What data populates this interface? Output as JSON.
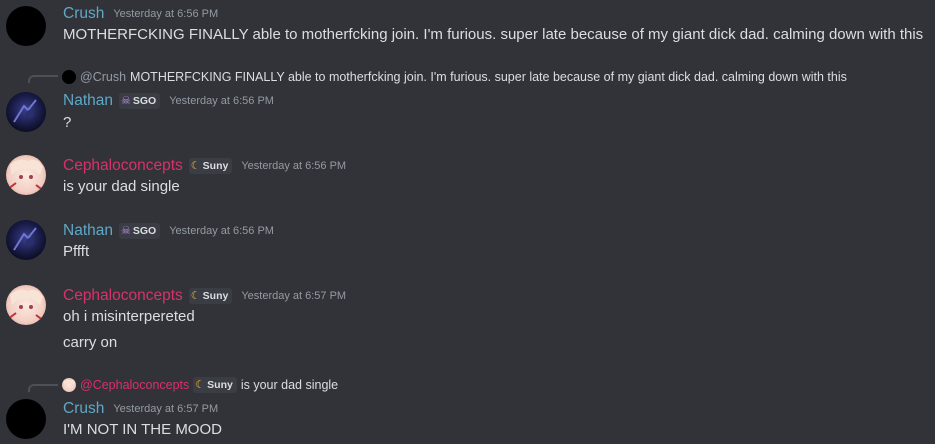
{
  "messages": {
    "m1": {
      "username": "Crush",
      "timestamp": "Yesterday at 6:56 PM",
      "text": "MOTHERFCKING FINALLY able to motherfcking join. I'm furious. super late because of my giant dick dad. calming down with this"
    },
    "m2": {
      "reply_mention": "@Crush",
      "reply_text": "MOTHERFCKING FINALLY able to motherfcking join. I'm furious. super late because of my giant dick dad. calming down with this",
      "username": "Nathan",
      "tag": "SGO",
      "timestamp": "Yesterday at 6:56 PM",
      "text": "?"
    },
    "m3": {
      "username": "Cephaloconcepts",
      "tag": "Suny",
      "timestamp": "Yesterday at 6:56 PM",
      "text": "is your dad single"
    },
    "m4": {
      "username": "Nathan",
      "tag": "SGO",
      "timestamp": "Yesterday at 6:56 PM",
      "text": "Pffft"
    },
    "m5": {
      "username": "Cephaloconcepts",
      "tag": "Suny",
      "timestamp": "Yesterday at 6:57 PM",
      "text": "oh i misinterpereted",
      "text2": "carry on"
    },
    "m6": {
      "reply_mention": "@Cephaloconcepts",
      "reply_tag": "Suny",
      "reply_text": "is your dad single",
      "username": "Crush",
      "timestamp": "Yesterday at 6:57 PM",
      "text": "I'M NOT IN THE MOOD"
    }
  },
  "colors": {
    "background": "#313338",
    "crush_name": "#5fa8c7",
    "nathan_name": "#5fa8c7",
    "ceph_name": "#d9316b",
    "timestamp": "#949ba4",
    "message_text": "#dbdee1"
  },
  "icons": {
    "sgo_tag": "skull-icon",
    "suny_tag": "crescent-moon-icon"
  }
}
